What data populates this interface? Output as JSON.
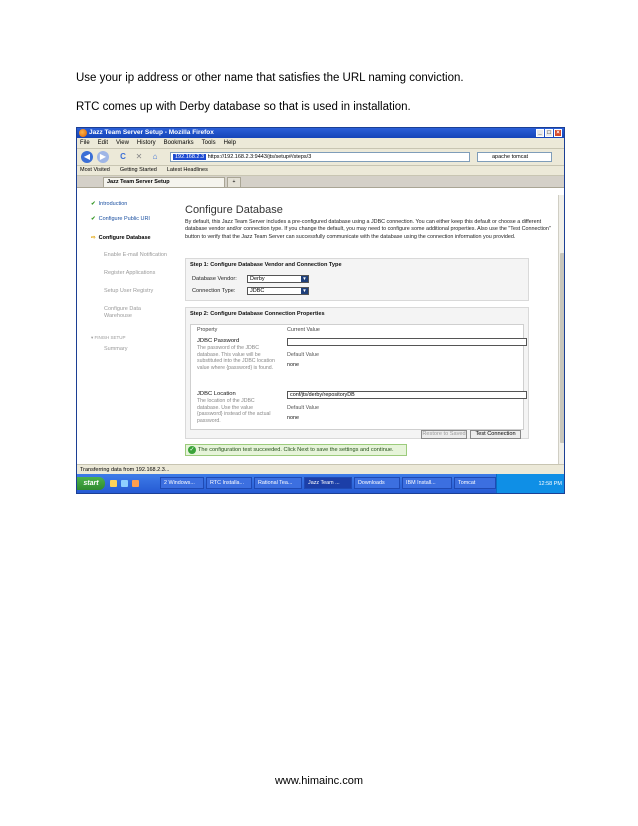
{
  "document": {
    "line1": "Use your ip address or other name that satisfies the URL naming conviction.",
    "line2": "RTC comes up with Derby database so that is used in installation.",
    "footer": "www.himainc.com"
  },
  "browser": {
    "title": "Jazz Team Server Setup - Mozilla Firefox",
    "menu": [
      "File",
      "Edit",
      "View",
      "History",
      "Bookmarks",
      "Tools",
      "Help"
    ],
    "url_host": "192.168.2.3",
    "url": "https://192.168.2.3:9443/jts/setup#/steps/3",
    "search": "apache tomcat",
    "bookmarks": [
      "Most Visited",
      "Getting Started",
      "Latest Headlines"
    ],
    "tab_title": "Jazz Team Server Setup",
    "tab_new": "+",
    "status": "Transferring data from 192.168.2.3..."
  },
  "setup_nav": {
    "items": [
      {
        "label": "Introduction",
        "state": "done"
      },
      {
        "label": "Configure Public URI",
        "state": "done"
      },
      {
        "label": "Configure Database",
        "state": "current"
      },
      {
        "label": "Enable E-mail Notification",
        "state": "disabled"
      },
      {
        "label": "Register Applications",
        "state": "disabled"
      },
      {
        "label": "Setup User Registry",
        "state": "disabled"
      },
      {
        "label": "Configure Data Warehouse",
        "state": "disabled"
      }
    ],
    "section": "FINISH SETUP",
    "summary": "Summary"
  },
  "main": {
    "heading": "Configure Database",
    "intro": "By default, this Jazz Team Server includes a pre-configured database using a JDBC connection. You can either keep this default or choose a different database vendor and/or connection type. If you change the default, you may need to configure some additional properties. Also use the \"Test Connection\" button to verify that the Jazz Team Server can successfully communicate with the database using the connection information you provided.",
    "step1": {
      "title": "Step 1:  Configure Database Vendor and Connection Type",
      "vendor_label": "Database Vendor:",
      "vendor_value": "Derby",
      "conn_label": "Connection Type:",
      "conn_value": "JDBC"
    },
    "step2": {
      "title": "Step 2:  Configure Database Connection Properties",
      "col_property": "Property",
      "col_value": "Current Value",
      "rows": [
        {
          "name": "JDBC Password",
          "desc": "The password of the JDBC database. This value will be substituted into the JDBC location value where {password} is found.",
          "value": "",
          "default_label": "Default Value",
          "default_value": "none"
        },
        {
          "name": "JDBC Location",
          "desc": "The location of the JDBC database. Use the value {password} instead of the actual password.",
          "value": "conf/jts/derby/repositoryDB",
          "default_label": "Default Value",
          "default_value": "none"
        }
      ],
      "restore_label": "Restore to Saved",
      "test_label": "Test Connection"
    },
    "success": "The configuration test succeeded. Click Next to save the settings and continue."
  },
  "taskbar": {
    "start": "start",
    "tasks": [
      "2 Windows...",
      "RTC Installa...",
      "Rational Tea...",
      "Jazz Team ...",
      "Downloads",
      "IBM Install...",
      "Tomcat"
    ],
    "clock": "12:58 PM"
  }
}
